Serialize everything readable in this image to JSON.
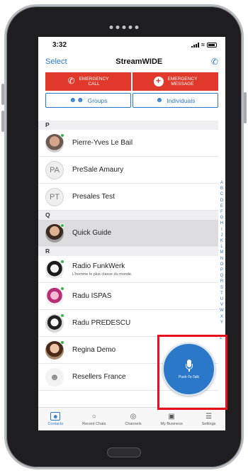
{
  "status_bar": {
    "time": "3:32"
  },
  "nav": {
    "select_label": "Select",
    "title": "StreamWIDE"
  },
  "emergency": {
    "call_label": "EMERGENCY\nCALL",
    "message_label": "EMERGENCY\nMESSAGE",
    "color": "#e0392b"
  },
  "segments": {
    "groups_label": "Groups",
    "individuals_label": "Individuals"
  },
  "sections": {
    "p": "P",
    "q": "Q",
    "r": "R"
  },
  "contacts": [
    {
      "name": "Pierre-Yves Le Bail",
      "avatar": "photo",
      "online": true
    },
    {
      "name": "PreSale Amaury",
      "avatar": "PA",
      "online": false
    },
    {
      "name": "Presales Test",
      "avatar": "PT",
      "online": false
    },
    {
      "name": "Quick Guide",
      "avatar": "photo",
      "online": true
    },
    {
      "name": "Radio FunkWerk",
      "subtitle": "L'homme le plus classe du monde.",
      "avatar": "photo",
      "online": true
    },
    {
      "name": "Radu ISPAS",
      "avatar": "photo",
      "online": true
    },
    {
      "name": "Radu PREDESCU",
      "avatar": "photo",
      "online": true
    },
    {
      "name": "Regina  Demo",
      "avatar": "photo",
      "online": true
    },
    {
      "name": "Resellers France",
      "avatar": "group-icon",
      "online": false
    }
  ],
  "alpha_index": [
    "A",
    "B",
    "C",
    "D",
    "E",
    "F",
    "G",
    "H",
    "I",
    "J",
    "K",
    "L",
    "M",
    "N",
    "O",
    "P",
    "Q",
    "R",
    "S",
    "T",
    "U",
    "V",
    "W",
    "X",
    "Y",
    "Z"
  ],
  "ptt": {
    "label": "Push-To-Talk",
    "color": "#2c78c8",
    "highlight_color": "#e8101c"
  },
  "tabs": [
    {
      "label": "Contacts",
      "icon": "contacts-icon",
      "active": true
    },
    {
      "label": "Recent Chats",
      "icon": "chat-bubbles-icon",
      "active": false
    },
    {
      "label": "Channels",
      "icon": "channels-icon",
      "active": false
    },
    {
      "label": "My Business",
      "icon": "business-icon",
      "active": false
    },
    {
      "label": "Settings",
      "icon": "settings-icon",
      "active": false
    }
  ],
  "accent_color": "#2c78c8"
}
